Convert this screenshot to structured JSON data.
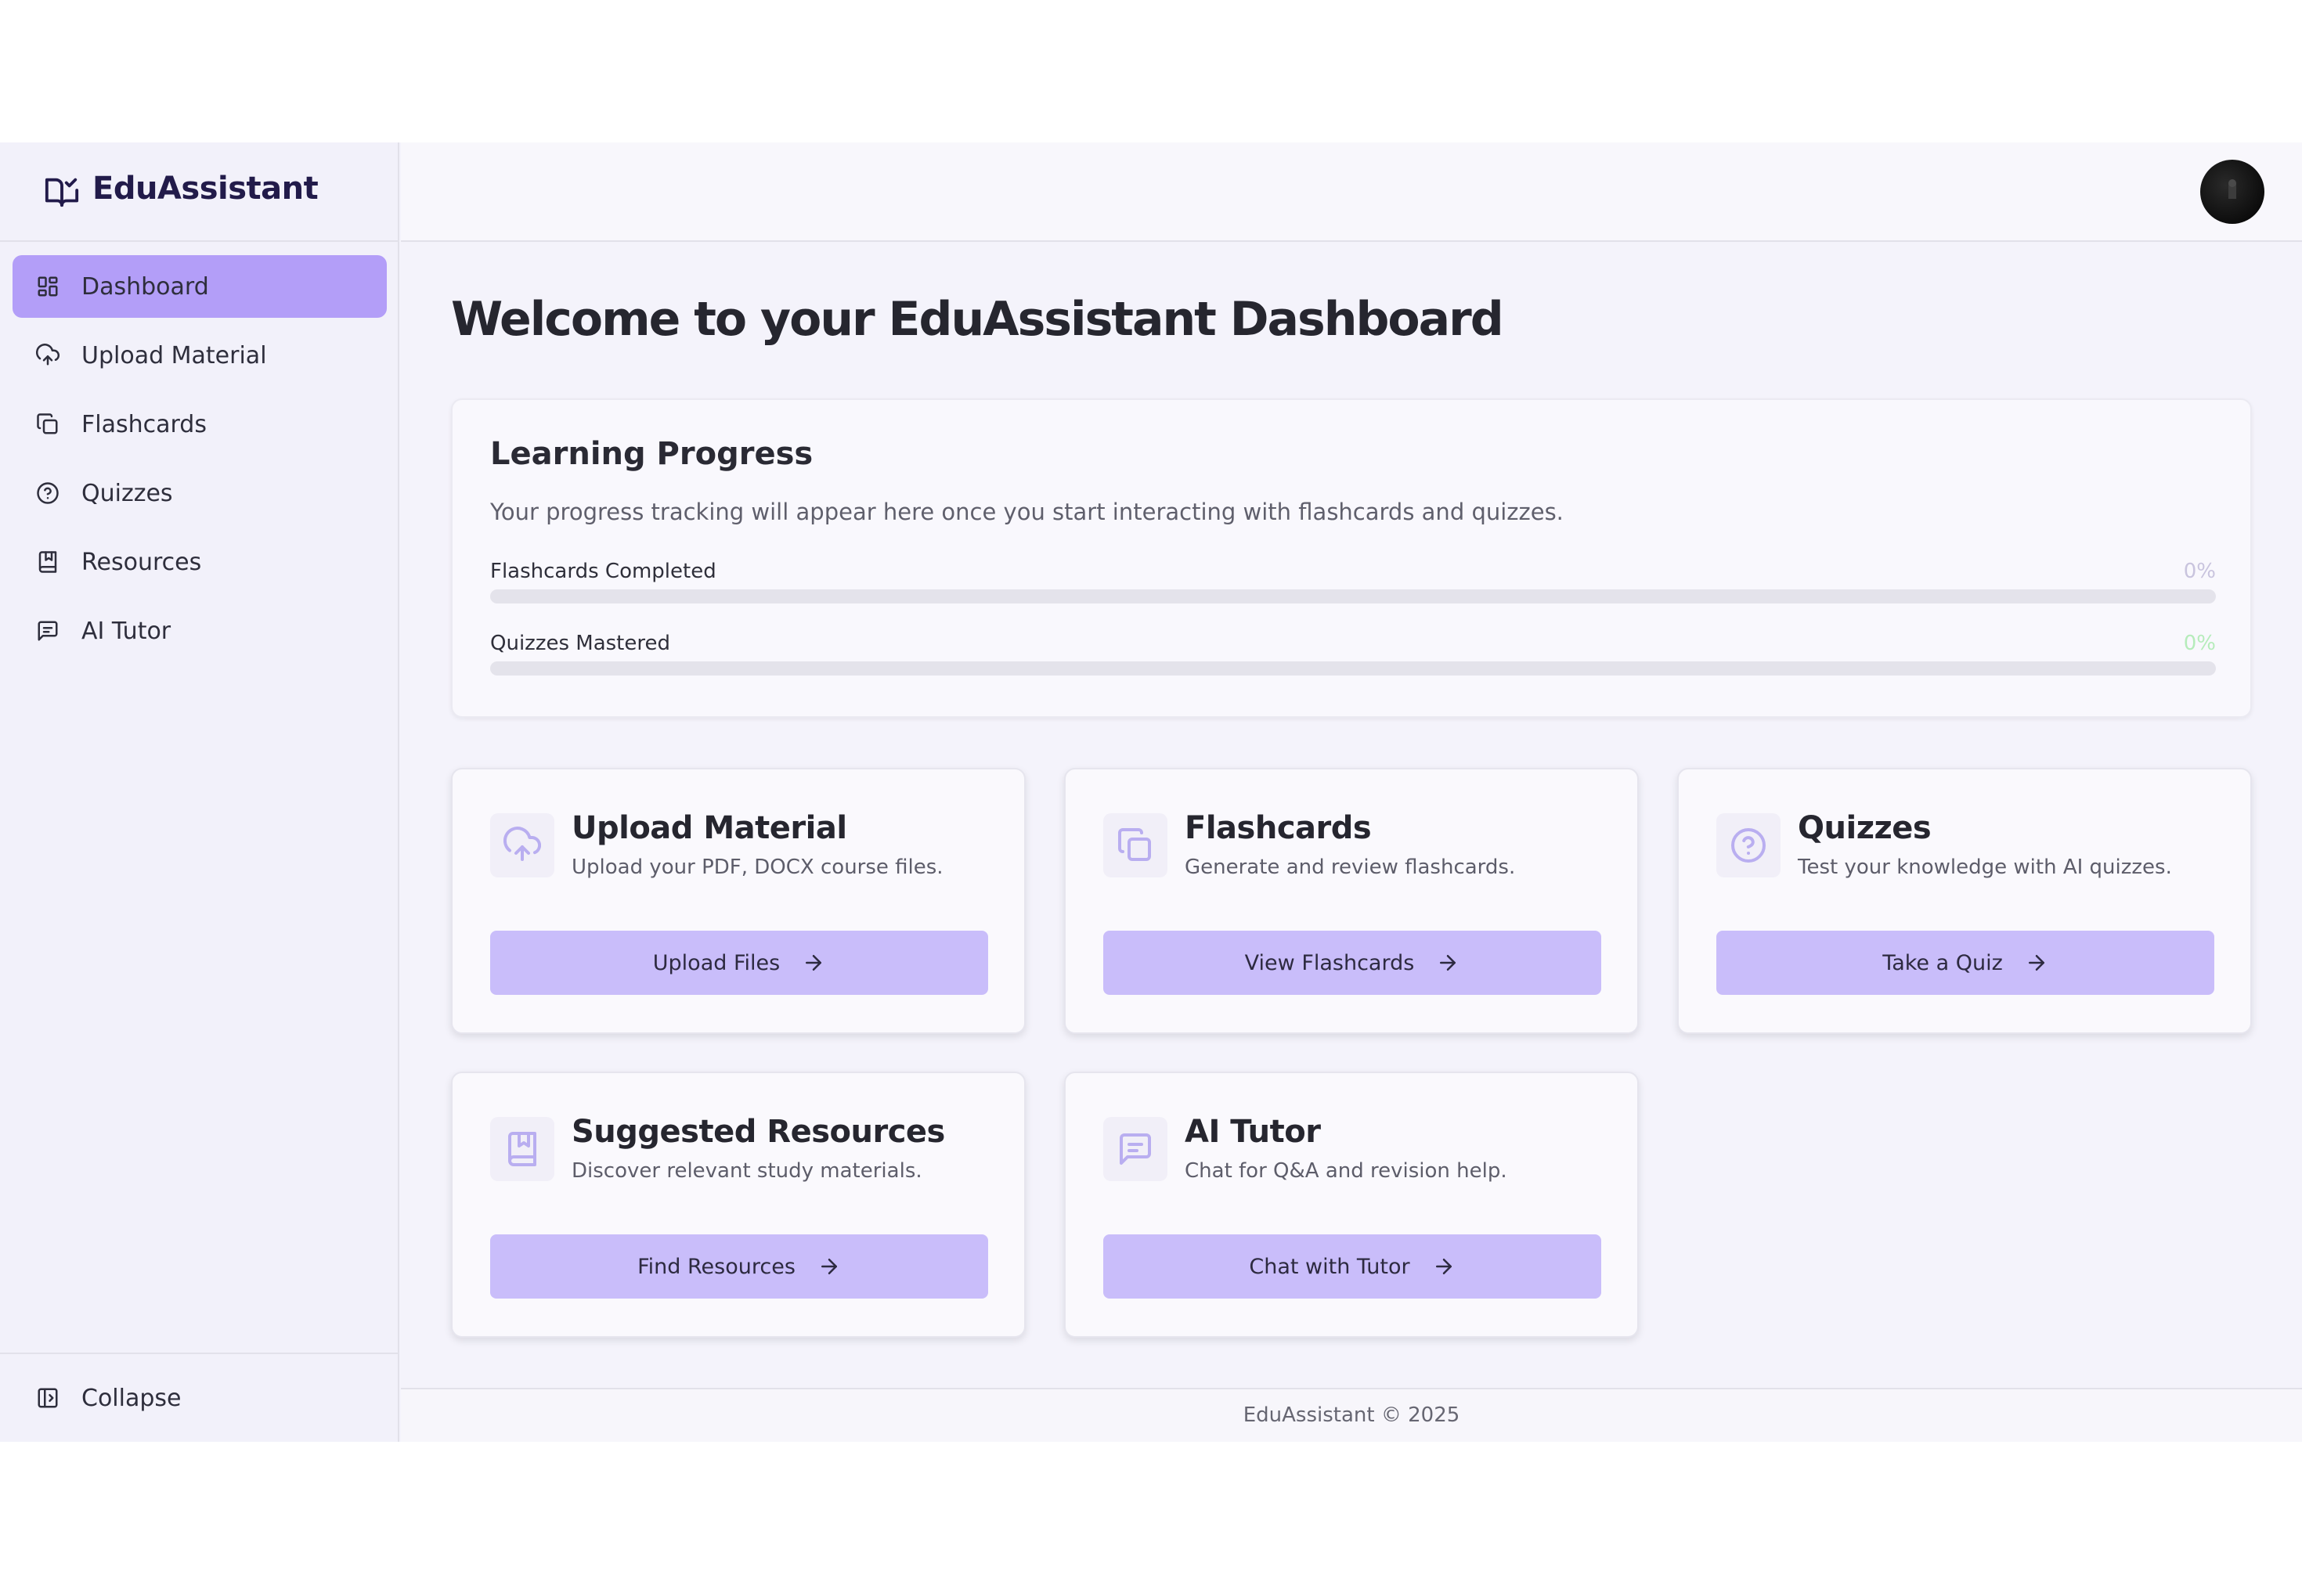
{
  "brand": {
    "name": "EduAssistant",
    "icon": "book-check-icon"
  },
  "sidebar": {
    "items": [
      {
        "label": "Dashboard",
        "icon": "dashboard-icon",
        "active": true
      },
      {
        "label": "Upload Material",
        "icon": "cloud-upload-icon",
        "active": false
      },
      {
        "label": "Flashcards",
        "icon": "copy-icon",
        "active": false
      },
      {
        "label": "Quizzes",
        "icon": "help-circle-icon",
        "active": false
      },
      {
        "label": "Resources",
        "icon": "bookmark-book-icon",
        "active": false
      },
      {
        "label": "AI Tutor",
        "icon": "message-square-icon",
        "active": false
      }
    ],
    "collapse_label": "Collapse"
  },
  "main": {
    "title": "Welcome to your EduAssistant Dashboard",
    "progress": {
      "title": "Learning Progress",
      "description": "Your progress tracking will appear here once you start interacting with flashcards and quizzes.",
      "rows": [
        {
          "label": "Flashcards Completed",
          "value": "0%",
          "fraction": 0,
          "value_color": "#c9c4de"
        },
        {
          "label": "Quizzes Mastered",
          "value": "0%",
          "fraction": 0,
          "value_color": "#b6ecbb"
        }
      ]
    },
    "cards": [
      {
        "title": "Upload Material",
        "description": "Upload your PDF, DOCX course files.",
        "button": "Upload Files",
        "icon": "cloud-upload-icon"
      },
      {
        "title": "Flashcards",
        "description": "Generate and review flashcards.",
        "button": "View Flashcards",
        "icon": "copy-icon"
      },
      {
        "title": "Quizzes",
        "description": "Test your knowledge with AI quizzes.",
        "button": "Take a Quiz",
        "icon": "help-circle-icon"
      },
      {
        "title": "Suggested Resources",
        "description": "Discover relevant study materials.",
        "button": "Find Resources",
        "icon": "bookmark-book-icon"
      },
      {
        "title": "AI Tutor",
        "description": "Chat for Q&A and revision help.",
        "button": "Chat with Tutor",
        "icon": "message-square-icon"
      }
    ]
  },
  "footer": {
    "text": "EduAssistant © 2025"
  },
  "colors": {
    "accent": "#b39ef8",
    "button": "#c9bdfa",
    "icon_muted": "#b9aef0"
  }
}
